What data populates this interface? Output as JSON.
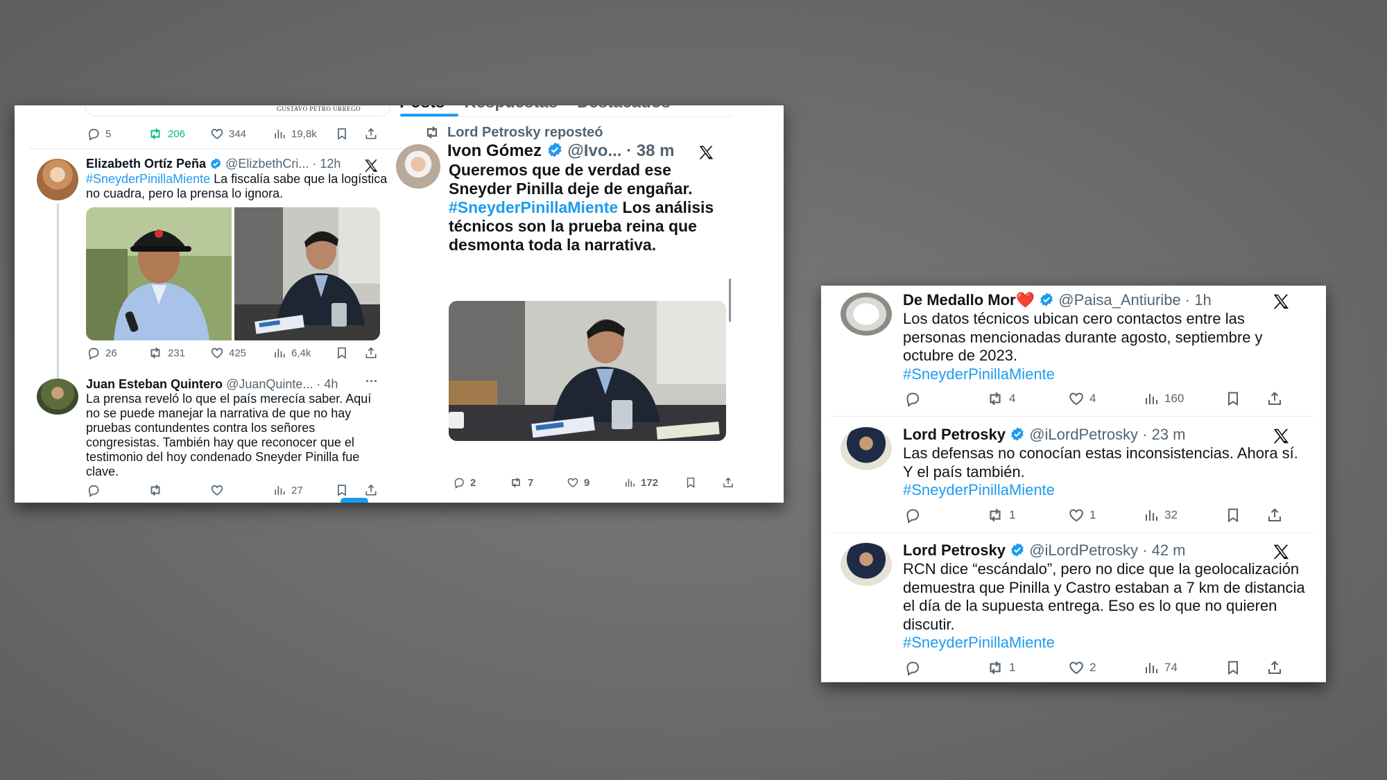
{
  "left_panel": {
    "top_strip_caption": "GUSTAVO PETRO URREGO",
    "top_actions": {
      "replies": "5",
      "reposts": "206",
      "likes": "344",
      "views": "19,8k"
    },
    "tweets": [
      {
        "name": "Elizabeth Ortíz Peña",
        "handle": "@ElizbethCri...",
        "time": "· 12h",
        "hashtag": "#SneyderPinillaMiente",
        "text": " La fiscalía sabe que la logística no cuadra, pero la prensa lo ignora.",
        "actions": {
          "replies": "26",
          "reposts": "231",
          "likes": "425",
          "views": "6,4k"
        }
      },
      {
        "name": "Juan Esteban Quintero",
        "handle": "@JuanQuinte...",
        "time": "· 4h",
        "more": "···",
        "text": "La prensa reveló lo que el país merecía saber. Aquí no se puede manejar la narrativa de que no hay pruebas contundentes contra los señores congresistas. También hay que reconocer que el testimonio del hoy condenado Sneyder Pinilla fue clave.",
        "actions": {
          "replies": "",
          "reposts": "",
          "likes": "",
          "views": "27"
        }
      }
    ]
  },
  "center_column": {
    "tabs": [
      "Posts",
      "Respuestas",
      "Destacados"
    ],
    "repost_label": "Lord Petrosky reposteó",
    "tweet": {
      "name": "Ivon Gómez",
      "handle": "@Ivo...",
      "time": "· 38 m",
      "text1": "Queremos que de verdad ese Sneyder Pinilla deje de engañar.",
      "hashtag": "#SneyderPinillaMiente",
      "text2": " Los análisis técnicos son la prueba reina que desmonta toda la narrativa.",
      "actions": {
        "replies": "2",
        "reposts": "7",
        "likes": "9",
        "views": "172"
      }
    }
  },
  "right_panel": {
    "tweets": [
      {
        "name": "De Medallo Mor",
        "name_emoji": "❤️",
        "handle": "@Paisa_Antiuribe",
        "time": "· 1h",
        "text": "Los datos técnicos ubican cero contactos entre las personas mencionadas durante agosto, septiembre y octubre de 2023.",
        "hashtag": "#SneyderPinillaMiente",
        "actions": {
          "replies": "",
          "reposts": "4",
          "likes": "4",
          "views": "160"
        }
      },
      {
        "name": "Lord Petrosky",
        "handle": "@iLordPetrosky",
        "time": "· 23 m",
        "text": "Las defensas no conocían estas inconsistencias. Ahora sí. Y el país también.",
        "hashtag": "#SneyderPinillaMiente",
        "actions": {
          "replies": "",
          "reposts": "1",
          "likes": "1",
          "views": "32"
        }
      },
      {
        "name": "Lord Petrosky",
        "handle": "@iLordPetrosky",
        "time": "· 42 m",
        "text": "RCN dice “escándalo”, pero no dice que la geolocalización demuestra que Pinilla y Castro estaban a 7 km de distancia el día de la supuesta entrega. Eso es lo que no quieren discutir.",
        "hashtag": "#SneyderPinillaMiente",
        "actions": {
          "replies": "",
          "reposts": "1",
          "likes": "2",
          "views": "74"
        }
      }
    ]
  },
  "colors": {
    "link": "#1d9bf0",
    "muted": "#536471",
    "repost_green": "#00ba7c",
    "background": "#6e6e6f"
  }
}
